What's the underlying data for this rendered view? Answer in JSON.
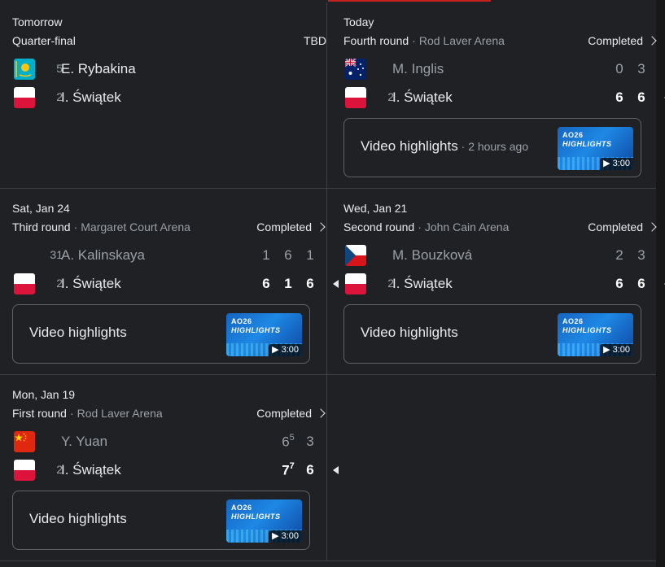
{
  "matches": [
    {
      "date": "Tomorrow",
      "round": "Quarter-final",
      "venue": "",
      "status": "TBD",
      "players": [
        {
          "seed": "5",
          "name": "E. Rybakina",
          "flag": "kazakhstan-flag-icon",
          "scores": [],
          "winner": false
        },
        {
          "seed": "2",
          "name": "I. Świątek",
          "flag": "poland-flag-icon",
          "scores": [],
          "winner": false
        }
      ]
    },
    {
      "date": "Today",
      "round": "Fourth round",
      "venue": "Rod Laver Arena",
      "status": "Completed",
      "players": [
        {
          "seed": "",
          "name": "M. Inglis",
          "flag": "australia-flag-icon",
          "scores": [
            "0",
            "3"
          ],
          "winner": false
        },
        {
          "seed": "2",
          "name": "I. Świątek",
          "flag": "poland-flag-icon",
          "scores": [
            "6",
            "6"
          ],
          "winner": true
        }
      ],
      "highlights": {
        "label": "Video highlights",
        "ago": "2 hours ago",
        "thumb_line1": "AO26",
        "thumb_line2": "HIGHLIGHTS",
        "duration": "▶ 3:00"
      }
    },
    {
      "date": "Sat, Jan 24",
      "round": "Third round",
      "venue": "Margaret Court Arena",
      "status": "Completed",
      "players": [
        {
          "seed": "31",
          "name": "A. Kalinskaya",
          "flag": "",
          "scores": [
            "1",
            "6",
            "1"
          ],
          "winner": false
        },
        {
          "seed": "2",
          "name": "I. Świątek",
          "flag": "poland-flag-icon",
          "scores": [
            "6",
            "1",
            "6"
          ],
          "winner": true
        }
      ],
      "highlights": {
        "label": "Video highlights",
        "ago": "",
        "thumb_line1": "AO26",
        "thumb_line2": "HIGHLIGHTS",
        "duration": "▶ 3:00"
      }
    },
    {
      "date": "Wed, Jan 21",
      "round": "Second round",
      "venue": "John Cain Arena",
      "status": "Completed",
      "players": [
        {
          "seed": "",
          "name": "M. Bouzková",
          "flag": "czechia-flag-icon",
          "scores": [
            "2",
            "3"
          ],
          "winner": false
        },
        {
          "seed": "2",
          "name": "I. Świątek",
          "flag": "poland-flag-icon",
          "scores": [
            "6",
            "6"
          ],
          "winner": true
        }
      ],
      "highlights": {
        "label": "Video highlights",
        "ago": "",
        "thumb_line1": "AO26",
        "thumb_line2": "HIGHLIGHTS",
        "duration": "▶ 3:00"
      }
    },
    {
      "date": "Mon, Jan 19",
      "round": "First round",
      "venue": "Rod Laver Arena",
      "status": "Completed",
      "players": [
        {
          "seed": "",
          "name": "Y. Yuan",
          "flag": "china-flag-icon",
          "scores": [
            "6",
            "3"
          ],
          "tiebreaks": [
            "5",
            ""
          ],
          "winner": false
        },
        {
          "seed": "2",
          "name": "I. Świątek",
          "flag": "poland-flag-icon",
          "scores": [
            "7",
            "6"
          ],
          "tiebreaks": [
            "7",
            ""
          ],
          "winner": true
        }
      ],
      "highlights": {
        "label": "Video highlights",
        "ago": "",
        "thumb_line1": "AO26",
        "thumb_line2": "HIGHLIGHTS",
        "duration": "▶ 3:00"
      }
    }
  ]
}
